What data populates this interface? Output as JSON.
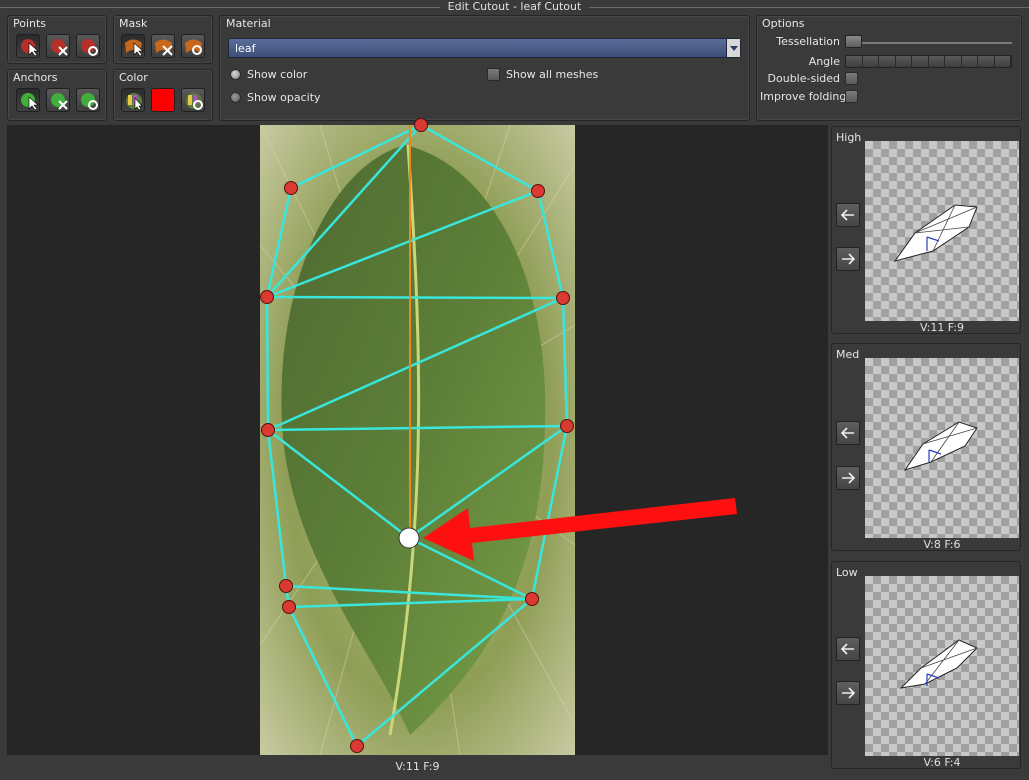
{
  "window": {
    "title": "Edit Cutout - leaf Cutout"
  },
  "groups": {
    "points": "Points",
    "mask": "Mask",
    "anchors": "Anchors",
    "color": "Color",
    "material": "Material",
    "options": "Options"
  },
  "material": {
    "selected": "leaf",
    "show_color": "Show color",
    "show_opacity": "Show opacity",
    "show_all_meshes": "Show all meshes",
    "selected_view": "Show color"
  },
  "options": {
    "tessellation": "Tessellation",
    "angle": "Angle",
    "double_sided": "Double-sided",
    "improve_folding": "Improve folding",
    "tessellation_level": 0.0
  },
  "colors": {
    "mask_color": "#ff0000",
    "mesh_edge": "#39e6dc",
    "point_fill": "#d93a32",
    "arrow": "#ff0000",
    "spine": "#e98a1a"
  },
  "icons": {
    "points": [
      "select-point-icon",
      "delete-point-icon",
      "reset-point-icon"
    ],
    "mask": [
      "select-mask-icon",
      "delete-mask-icon",
      "reset-mask-icon"
    ],
    "anchors": [
      "select-anchor-icon",
      "delete-anchor-icon",
      "reset-anchor-icon"
    ],
    "color": [
      "pick-color-icon",
      "color-swatch",
      "reset-color-icon"
    ]
  },
  "viewport": {
    "stats": "V:11  F:9"
  },
  "lods": [
    {
      "label": "High",
      "stats": "V:11  F:9"
    },
    {
      "label": "Med",
      "stats": "V:8  F:6"
    },
    {
      "label": "Low",
      "stats": "V:6  F:4"
    }
  ]
}
